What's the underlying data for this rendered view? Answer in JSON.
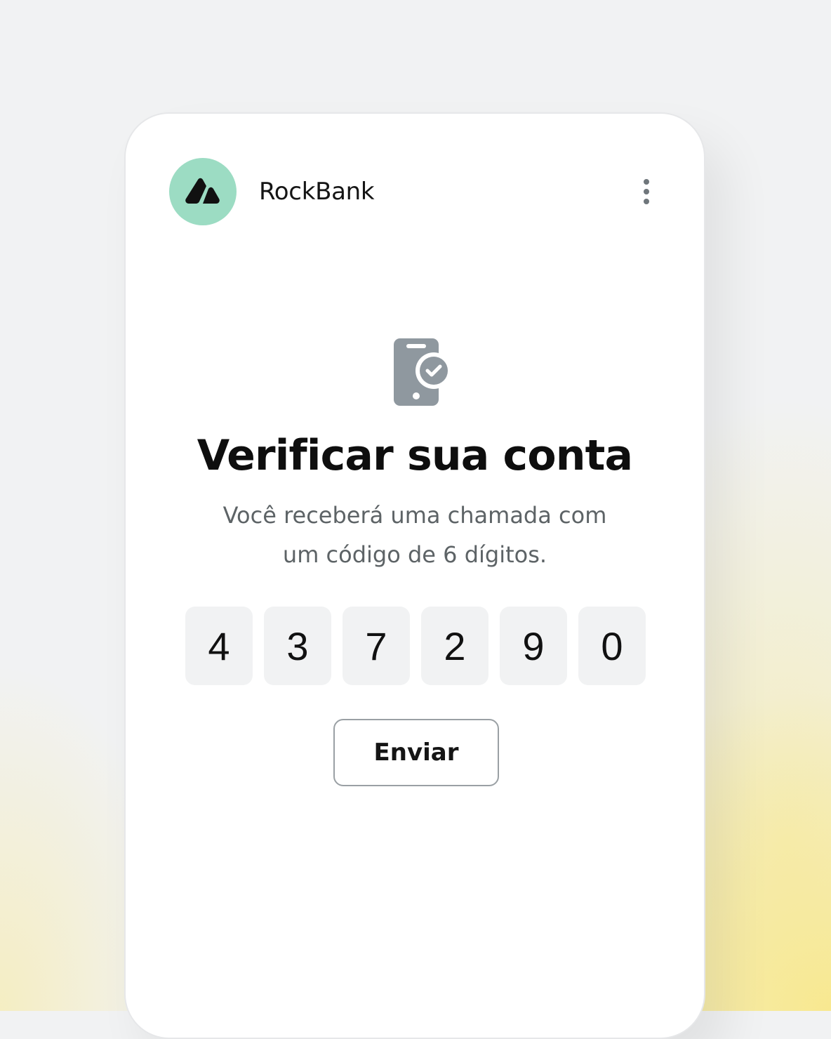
{
  "app": {
    "brand_name": "RockBank",
    "logo_icon": "mountain-icon",
    "menu_icon": "more-vertical-icon",
    "colors": {
      "logo_bg": "#9cdcc3",
      "icon_gray": "#8f989f",
      "digit_bg": "#f1f2f3"
    }
  },
  "verification": {
    "icon": "phone-check-icon",
    "title": "Verificar sua conta",
    "subtitle_line1": "Você receberá uma chamada com",
    "subtitle_line2": "um código de 6 dígitos.",
    "code_digits": [
      "4",
      "3",
      "7",
      "2",
      "9",
      "0"
    ],
    "submit_label": "Enviar"
  }
}
